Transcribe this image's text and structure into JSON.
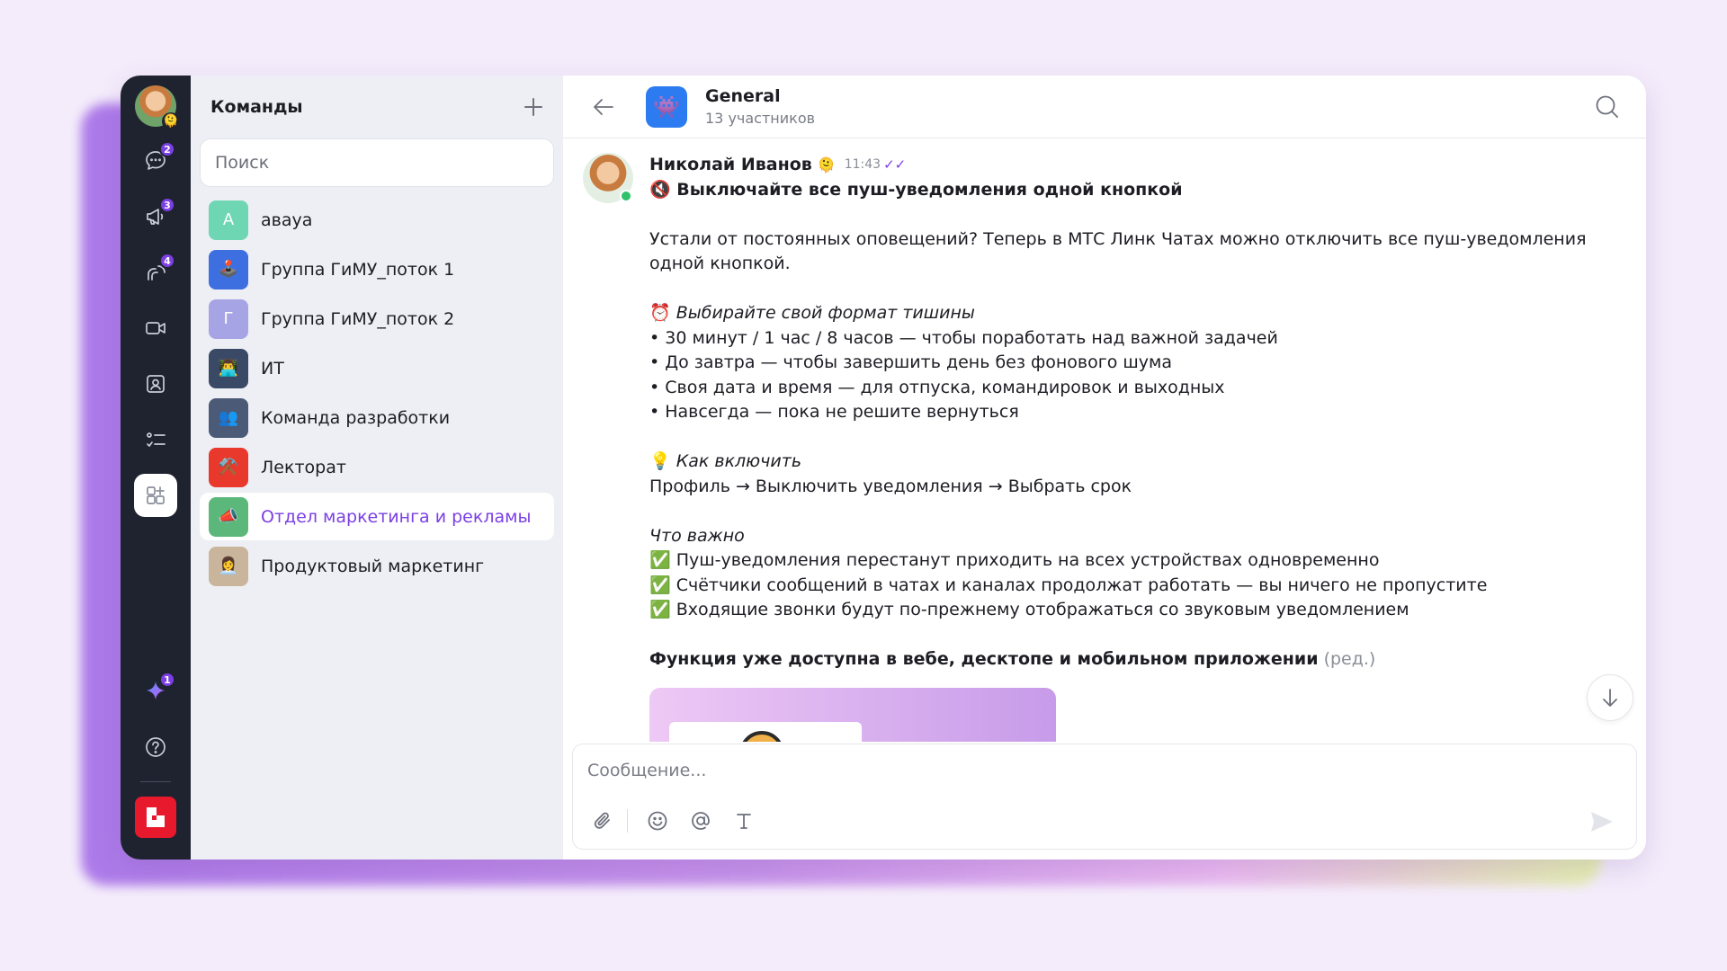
{
  "rail": {
    "badges": {
      "chats": "2",
      "channels": "3",
      "threads": "4",
      "ai": "1"
    },
    "avatar_emoji": "🫠"
  },
  "teams": {
    "title": "Команды",
    "search_placeholder": "Поиск",
    "items": [
      {
        "label": "авауа",
        "icon_text": "А",
        "icon_bg": "#6fd6b4"
      },
      {
        "label": "Группа ГиМУ_поток 1",
        "icon_text": "🕹️",
        "icon_bg": "#3e6fe0"
      },
      {
        "label": "Группа ГиМУ_поток 2",
        "icon_text": "Г",
        "icon_bg": "#a7a4e6"
      },
      {
        "label": "ИТ",
        "icon_text": "👨‍💻",
        "icon_bg": "#3a4a66"
      },
      {
        "label": "Команда разработки",
        "icon_text": "👥",
        "icon_bg": "#4a5a77"
      },
      {
        "label": "Лекторат",
        "icon_text": "⚒️",
        "icon_bg": "#e8392c"
      },
      {
        "label": "Отдел маркетинга и рекламы",
        "icon_text": "📣",
        "icon_bg": "#5cb87a"
      },
      {
        "label": "Продуктовый маркетинг",
        "icon_text": "👩‍💼",
        "icon_bg": "#c9b59c"
      }
    ]
  },
  "chat": {
    "name": "General",
    "members": "13 участников",
    "icon": "👾",
    "composer_placeholder": "Сообщение..."
  },
  "message": {
    "author": "Николай Иванов",
    "author_emoji": "🫠",
    "time": "11:43",
    "ticks": "✓✓",
    "headline_icon": "🔇",
    "headline": "Выключайте все пуш-уведомления одной кнопкой",
    "intro": "Устали от постоянных оповещений? Теперь в МТС Линк Чатах можно отключить все пуш-уведомления одной кнопкой.",
    "format_icon": "⏰",
    "format_title": "Выбирайте свой формат тишины",
    "format_items": [
      "• 30 минут / 1 час / 8 часов — чтобы поработать над важной задачей",
      "• До завтра — чтобы завершить день без фонового шума",
      "• Своя дата и время — для отпуска, командировок и выходных",
      "• Навсегда — пока не решите вернуться"
    ],
    "howto_icon": "💡",
    "howto_title": "Как включить",
    "howto_text": "Профиль → Выключить уведомления → Выбрать срок",
    "important_title": "Что важно",
    "important_items": [
      "✅ Пуш-уведомления перестанут приходить на всех устройствах одновременно",
      "✅ Счётчики сообщений в чатах и каналах продолжат работать — вы ничего не пропустите",
      "✅ Входящие звонки будут по-прежнему отображаться со звуковым уведомлением"
    ],
    "footer": "Функция уже доступна в вебе, десктопе и мобильном приложении",
    "edited": "(ред.)"
  }
}
